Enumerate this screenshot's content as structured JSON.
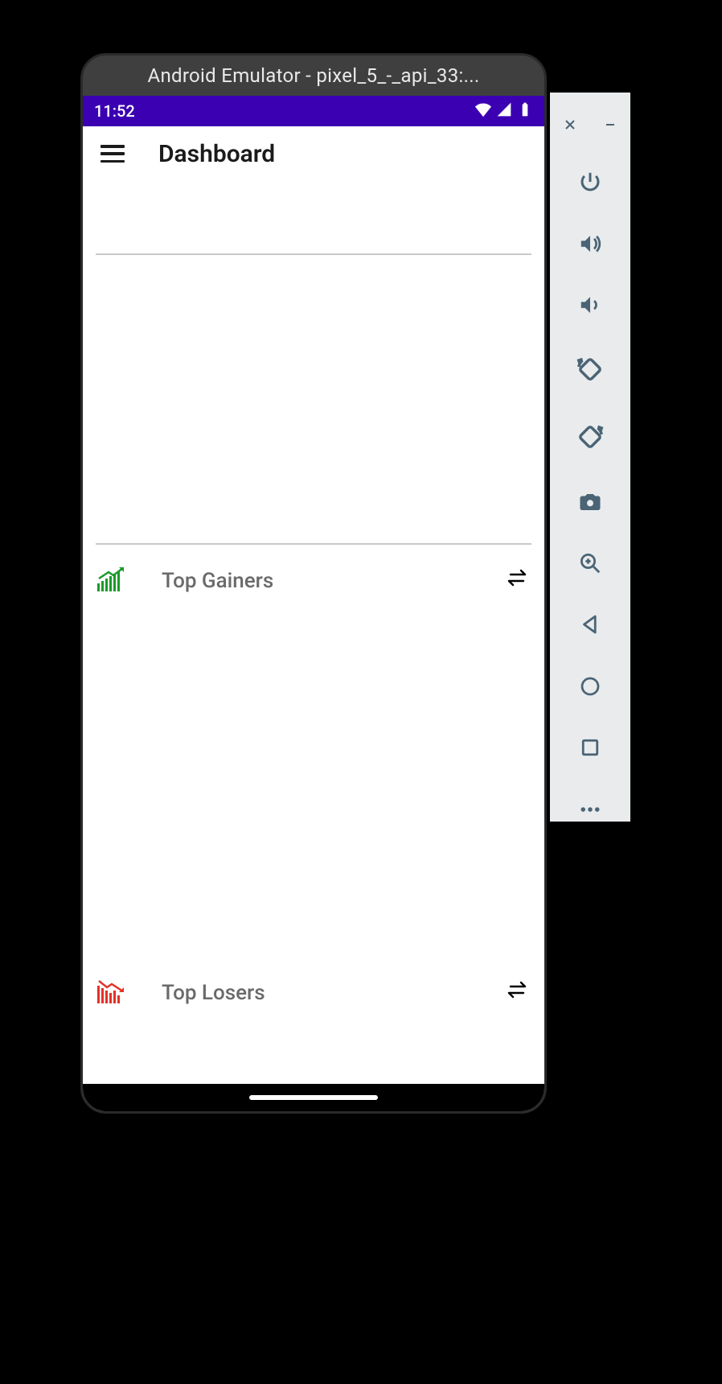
{
  "emulator": {
    "title": "Android Emulator - pixel_5_-_api_33:...",
    "controls": {
      "close": "close",
      "minimize": "minimize",
      "power": "power",
      "volume_up": "volume-up",
      "volume_down": "volume-down",
      "rotate_left": "rotate-left",
      "rotate_right": "rotate-right",
      "screenshot": "screenshot",
      "zoom": "zoom",
      "back": "back",
      "home": "home",
      "overview": "overview",
      "more": "more"
    }
  },
  "status_bar": {
    "time": "11:52",
    "wifi_icon": "wifi",
    "signal_icon": "cellular",
    "battery_icon": "battery-full"
  },
  "app": {
    "title": "Dashboard",
    "menu_icon": "menu",
    "sections": [
      {
        "id": "top_gainers",
        "label": "Top Gainers",
        "icon": "chart-up",
        "icon_color": "#1a9b2a",
        "action_icon": "swap"
      },
      {
        "id": "top_losers",
        "label": "Top Losers",
        "icon": "chart-down",
        "icon_color": "#e23228",
        "action_icon": "swap"
      }
    ]
  }
}
